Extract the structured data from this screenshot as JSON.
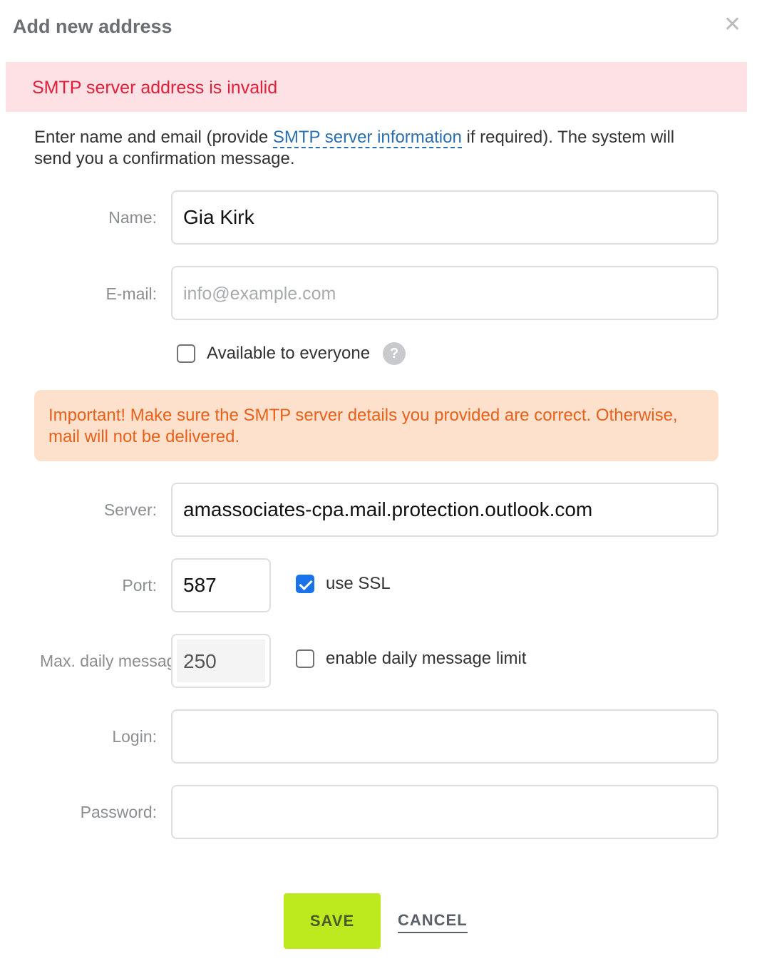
{
  "dialog": {
    "title": "Add new address",
    "close_icon": "close-icon"
  },
  "error_banner": {
    "text": "SMTP server address is invalid",
    "color": "#e0203a",
    "background": "#fde1e4"
  },
  "intro": {
    "before_link": "Enter name and email (provide ",
    "link_text": "SMTP server information",
    "after_link": " if required). The system will send you a confirmation message."
  },
  "form": {
    "name_label": "Name:",
    "name_value": "Gia Kirk",
    "email_label": "E-mail:",
    "email_value": "",
    "email_placeholder": "info@example.com",
    "available_label": "Available to everyone",
    "available_checked": false,
    "help_icon": "question-icon",
    "help_glyph": "?",
    "warning_text": "Important! Make sure the SMTP server details you provided are correct. Otherwise, mail will not be delivered.",
    "server_label": "Server:",
    "server_value": "amassociates-cpa.mail.protection.outlook.com",
    "port_label": "Port:",
    "port_value": "587",
    "ssl_label": "use SSL",
    "ssl_checked": true,
    "max_daily_label": "Max. daily messages:",
    "max_daily_value": "250",
    "daily_limit_label": "enable daily message limit",
    "daily_limit_checked": false,
    "login_label": "Login:",
    "login_value": "",
    "password_label": "Password:",
    "password_value": ""
  },
  "actions": {
    "save_label": "SAVE",
    "cancel_label": "CANCEL",
    "save_color": "#bde91f"
  },
  "colors": {
    "accent_blue": "#1a73e8",
    "link": "#2c6fb0",
    "warning_text": "#e8611a",
    "warning_bg": "#fde1cc"
  }
}
